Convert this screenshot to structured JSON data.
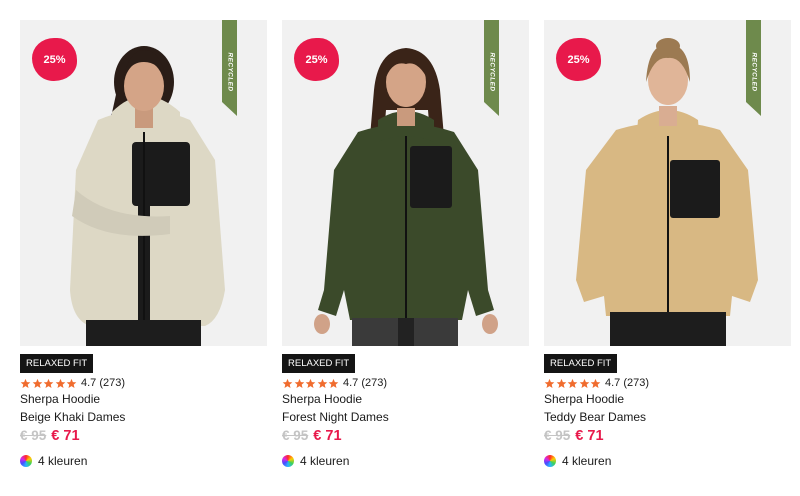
{
  "products": [
    {
      "discount": "25%",
      "ribbon": "RECYCLED",
      "badge": "RELAXED FIT",
      "rating": "4.7 (273)",
      "name": "Sherpa Hoodie",
      "variant": "Beige Khaki Dames",
      "old_price": "€ 95",
      "new_price": "€ 71",
      "colors": "4 kleuren",
      "jacket_color": "#ddd8c5",
      "hair_color": "#2a1d17"
    },
    {
      "discount": "25%",
      "ribbon": "RECYCLED",
      "badge": "RELAXED FIT",
      "rating": "4.7 (273)",
      "name": "Sherpa Hoodie",
      "variant": "Forest Night Dames",
      "old_price": "€ 95",
      "new_price": "€ 71",
      "colors": "4 kleuren",
      "jacket_color": "#3b4a2a",
      "hair_color": "#3a2418"
    },
    {
      "discount": "25%",
      "ribbon": "RECYCLED",
      "badge": "RELAXED FIT",
      "rating": "4.7 (273)",
      "name": "Sherpa Hoodie",
      "variant": "Teddy Bear Dames",
      "old_price": "€ 95",
      "new_price": "€ 71",
      "colors": "4 kleuren",
      "jacket_color": "#d8b883",
      "hair_color": "#9c7a52"
    }
  ],
  "colors": {
    "accent": "#e8194b",
    "ribbon": "#6e8a4c",
    "star": "#f06c2e",
    "badge_bg": "#141414",
    "image_bg": "#f1f1f1"
  }
}
